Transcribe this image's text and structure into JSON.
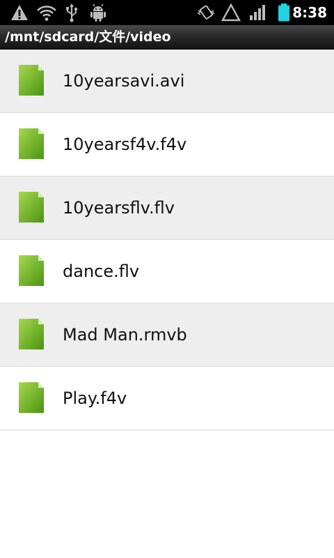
{
  "status_bar": {
    "icons": [
      "warning-icon",
      "wifi-icon",
      "usb-icon",
      "android-debug-icon",
      "vibrate-icon",
      "alert-triangle-icon",
      "signal-icon",
      "battery-icon"
    ],
    "time": "8:38",
    "colors": {
      "background": "#000000",
      "icon": "#bbbbbb",
      "battery": "#1fd3e0"
    }
  },
  "path_bar": {
    "path": "/mnt/sdcard/文件/video"
  },
  "files": [
    {
      "name": "10yearsavi.avi"
    },
    {
      "name": "10yearsf4v.f4v"
    },
    {
      "name": "10yearsflv.flv"
    },
    {
      "name": "dance.flv"
    },
    {
      "name": "Mad Man.rmvb"
    },
    {
      "name": "Play.f4v"
    }
  ],
  "colors": {
    "row_alt": "#eeeeee",
    "row": "#ffffff",
    "file_icon_light": "#9fd34a",
    "file_icon_dark": "#4f9a15"
  }
}
